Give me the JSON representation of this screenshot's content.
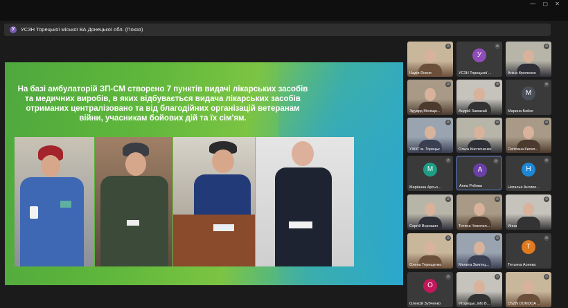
{
  "window": {
    "controls": "— ▢ ✕"
  },
  "share": {
    "presenter_initial": "У",
    "title": "УСЗН Торецької міської ВА Донецької обл. (Показ)"
  },
  "slide": {
    "text": "На базі амбулаторій ЗП-СМ створено 7 пунктів видачі лікарських засобів та медичних виробів, в яких відбувається видача лікарських засобів отриманих централізовано та від благодійних організацій ветеранам війни, учасникам бойових дій та їх сім'ям."
  },
  "participants": [
    {
      "name": "Надія Ясеня",
      "type": "video"
    },
    {
      "name": "УСЗН Торецької ...",
      "type": "avatar",
      "initial": "У",
      "color": "#8e4db8"
    },
    {
      "name": "Аліна Фроленко",
      "type": "video"
    },
    {
      "name": "Эдуард Меліщо...",
      "type": "video"
    },
    {
      "name": "Андрій Замахай",
      "type": "video"
    },
    {
      "name": "Марина Бойко",
      "type": "avatar",
      "initial": "М",
      "color": "#4a4f5a"
    },
    {
      "name": "УЖКГ м. Торецьк",
      "type": "video"
    },
    {
      "name": "Ольга Кислюченко",
      "type": "video"
    },
    {
      "name": "Світлана Кисел...",
      "type": "video"
    },
    {
      "name": "Маріанна Арсьо...",
      "type": "avatar",
      "initial": "М",
      "color": "#1f9e86"
    },
    {
      "name": "Анна Рябова",
      "type": "avatar",
      "initial": "А",
      "color": "#6b3fa8",
      "active": true
    },
    {
      "name": "Наталья Антипе...",
      "type": "avatar",
      "initial": "Н",
      "color": "#1e88d6"
    },
    {
      "name": "Сергій Ворошин",
      "type": "video"
    },
    {
      "name": "Тетяна Чевичел...",
      "type": "video"
    },
    {
      "name": "Инна",
      "type": "video"
    },
    {
      "name": "Олена Терещенко",
      "type": "video"
    },
    {
      "name": "Мелита Звягінц...",
      "type": "video"
    },
    {
      "name": "Тетьяна Асеева",
      "type": "avatar",
      "initial": "Т",
      "color": "#e07a1f"
    },
    {
      "name": "Олексій Зубченко",
      "type": "avatar",
      "initial": "О",
      "color": "#c2185b"
    },
    {
      "name": "#Торецьк_info В...",
      "type": "video"
    },
    {
      "name": "DSZN DONOOA ...",
      "type": "video"
    }
  ]
}
